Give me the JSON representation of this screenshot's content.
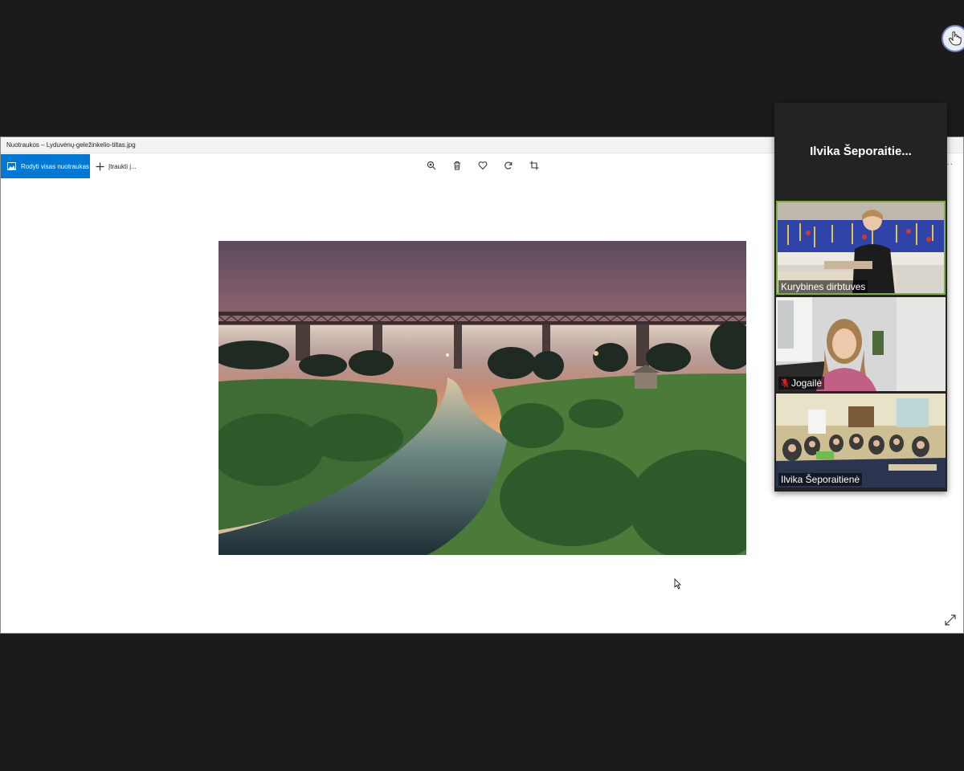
{
  "window": {
    "title": "Nuotraukos – Lyduvėnų-geležinkelio-tiltas.jpg"
  },
  "toolbar": {
    "show_all_label": "Rodyti visas nuotraukas",
    "insert_label": "Įtraukti į...",
    "icons": [
      "zoom-in-icon",
      "trash-icon",
      "heart-icon",
      "rotate-icon",
      "crop-icon"
    ]
  },
  "photo": {
    "subject": "railway-bridge-over-river-at-sunrise"
  },
  "gallery": {
    "header_name": "Ilvika  Šeporaitie...",
    "participants": [
      {
        "name": "Kurybines dirbtuves",
        "muted": false,
        "active": true
      },
      {
        "name": "Jogailė",
        "muted": true,
        "active": false
      },
      {
        "name": "Ilvika Šeporaitienė",
        "muted": false,
        "active": false
      }
    ]
  },
  "colors": {
    "accent": "#0078d4",
    "active_speaker": "#7fb13a",
    "background": "#1b1b1b",
    "muted_icon": "#e02020"
  }
}
